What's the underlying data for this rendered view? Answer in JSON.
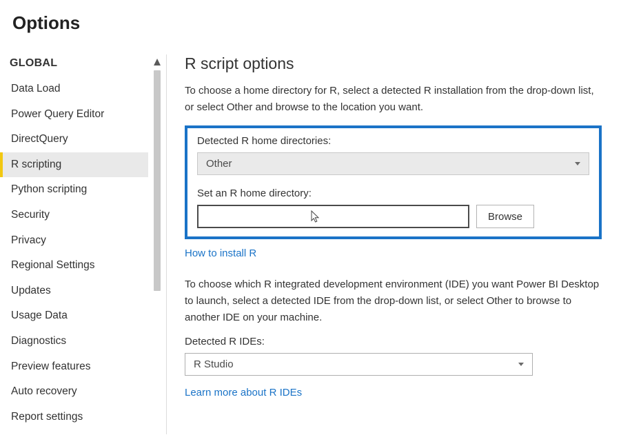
{
  "pageTitle": "Options",
  "sidebar": {
    "groupLabel": "GLOBAL",
    "items": [
      {
        "label": "Data Load",
        "active": false
      },
      {
        "label": "Power Query Editor",
        "active": false
      },
      {
        "label": "DirectQuery",
        "active": false
      },
      {
        "label": "R scripting",
        "active": true
      },
      {
        "label": "Python scripting",
        "active": false
      },
      {
        "label": "Security",
        "active": false
      },
      {
        "label": "Privacy",
        "active": false
      },
      {
        "label": "Regional Settings",
        "active": false
      },
      {
        "label": "Updates",
        "active": false
      },
      {
        "label": "Usage Data",
        "active": false
      },
      {
        "label": "Diagnostics",
        "active": false
      },
      {
        "label": "Preview features",
        "active": false
      },
      {
        "label": "Auto recovery",
        "active": false
      },
      {
        "label": "Report settings",
        "active": false
      }
    ]
  },
  "content": {
    "heading": "R script options",
    "intro1": "To choose a home directory for R, select a detected R installation from the drop-down list, or select Other and browse to the location you want.",
    "detectedHomeLabel": "Detected R home directories:",
    "detectedHomeValue": "Other",
    "setHomeLabel": "Set an R home directory:",
    "setHomeValue": "",
    "browseLabel": "Browse",
    "howToInstallLink": "How to install R",
    "intro2": "To choose which R integrated development environment (IDE) you want Power BI Desktop to launch, select a detected IDE from the drop-down list, or select Other to browse to another IDE on your machine.",
    "detectedIdeLabel": "Detected R IDEs:",
    "detectedIdeValue": "R Studio",
    "learnMoreIdeLink": "Learn more about R IDEs"
  }
}
